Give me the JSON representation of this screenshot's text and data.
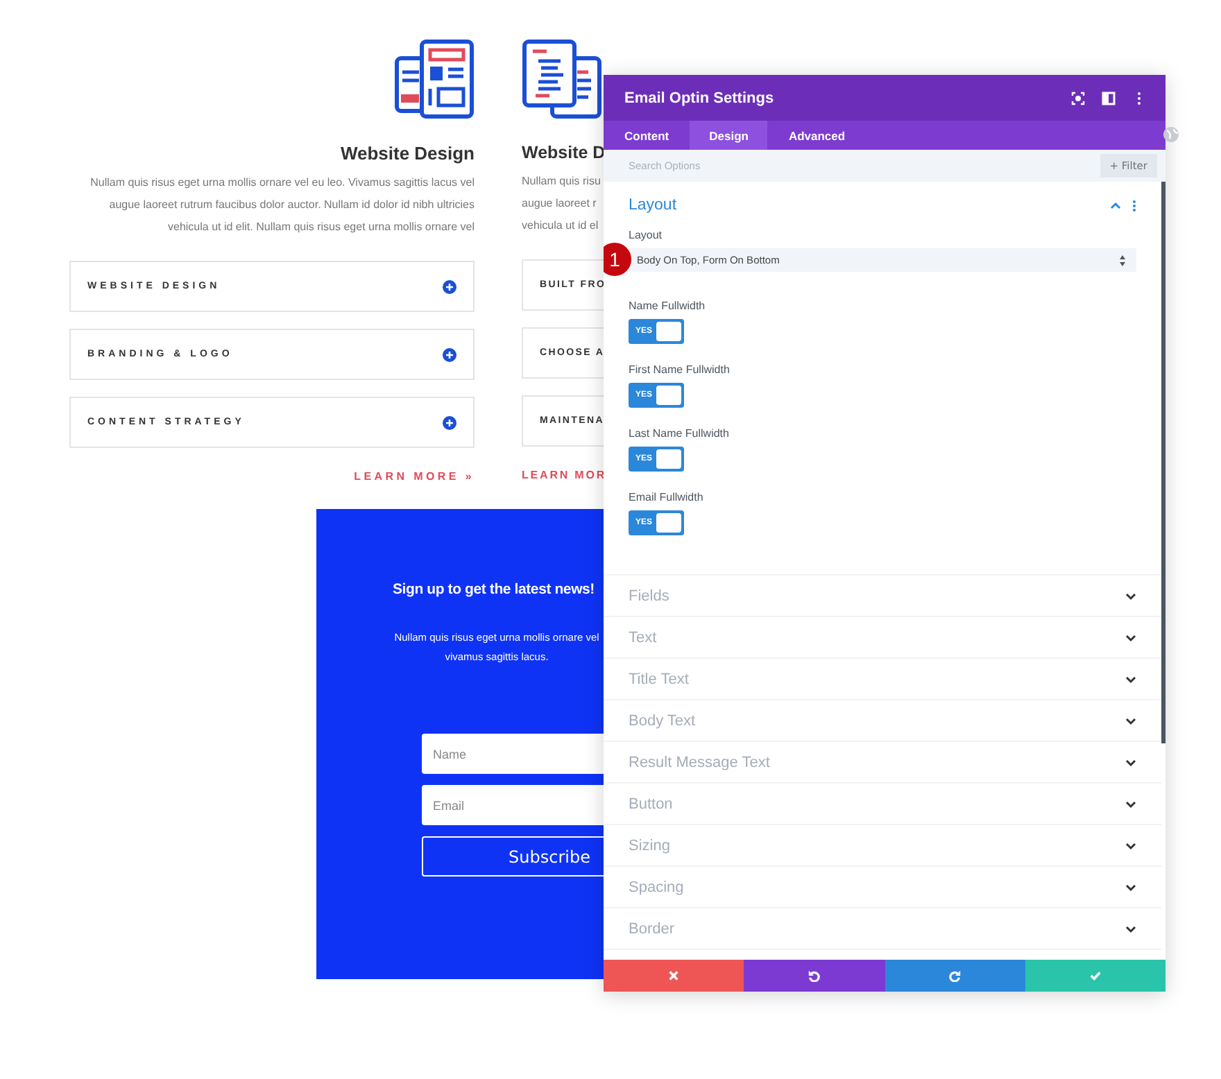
{
  "columns": [
    {
      "title": "Website Design",
      "body": [
        "Nullam quis risus eget urna mollis ornare vel eu leo. Vivamus sagittis lacus vel",
        "augue laoreet rutrum faucibus dolor auctor. Nullam id dolor id nibh ultricies",
        "vehicula ut id elit. Nullam quis risus eget urna mollis ornare vel"
      ],
      "toggles": [
        {
          "label": "WEBSITE DESIGN"
        },
        {
          "label": "BRANDING & LOGO"
        },
        {
          "label": "CONTENT STRATEGY"
        }
      ],
      "link": "LEARN MORE »"
    },
    {
      "title": "Website D",
      "body": [
        "Nullam quis risu",
        "augue laoreet r",
        "vehicula ut id el"
      ],
      "toggles": [
        {
          "label": "BUILT FRO"
        },
        {
          "label": "CHOOSE A"
        },
        {
          "label": "MAINTENA"
        }
      ],
      "link": "LEARN MOR"
    }
  ],
  "optin": {
    "title": "Sign up to get the latest news!",
    "body": [
      "Nullam quis risus eget urna mollis ornare vel",
      "vivamus sagittis lacus."
    ],
    "fields": [
      {
        "placeholder": "Name"
      },
      {
        "placeholder": "Email"
      }
    ],
    "button": "Subscribe"
  },
  "panel": {
    "title": "Email Optin Settings",
    "tabs": [
      {
        "label": "Content",
        "selected": false
      },
      {
        "label": "Design",
        "selected": true
      },
      {
        "label": "Advanced",
        "selected": false
      }
    ],
    "search": {
      "placeholder": "Search Options"
    },
    "filter": "+ Filter",
    "sections": [
      {
        "title": "Layout",
        "expanded": true,
        "select_label": "Layout",
        "select_value": "Body On Top, Form On Bottom",
        "badge": "1",
        "switches": [
          {
            "label": "Name Fullwidth",
            "text": "YES",
            "on": true
          },
          {
            "label": "First Name Fullwidth",
            "text": "YES",
            "on": true
          },
          {
            "label": "Last Name Fullwidth",
            "text": "YES",
            "on": true
          },
          {
            "label": "Email Fullwidth",
            "text": "YES",
            "on": true
          }
        ]
      },
      {
        "title": "Fields",
        "expanded": false
      },
      {
        "title": "Text",
        "expanded": false
      },
      {
        "title": "Title Text",
        "expanded": false
      },
      {
        "title": "Body Text",
        "expanded": false
      },
      {
        "title": "Result Message Text",
        "expanded": false
      },
      {
        "title": "Button",
        "expanded": false
      },
      {
        "title": "Sizing",
        "expanded": false
      },
      {
        "title": "Spacing",
        "expanded": false
      },
      {
        "title": "Border",
        "expanded": false
      }
    ],
    "footer": [
      {
        "kind": "cancel"
      },
      {
        "kind": "undo"
      },
      {
        "kind": "redo"
      },
      {
        "kind": "save"
      }
    ]
  }
}
